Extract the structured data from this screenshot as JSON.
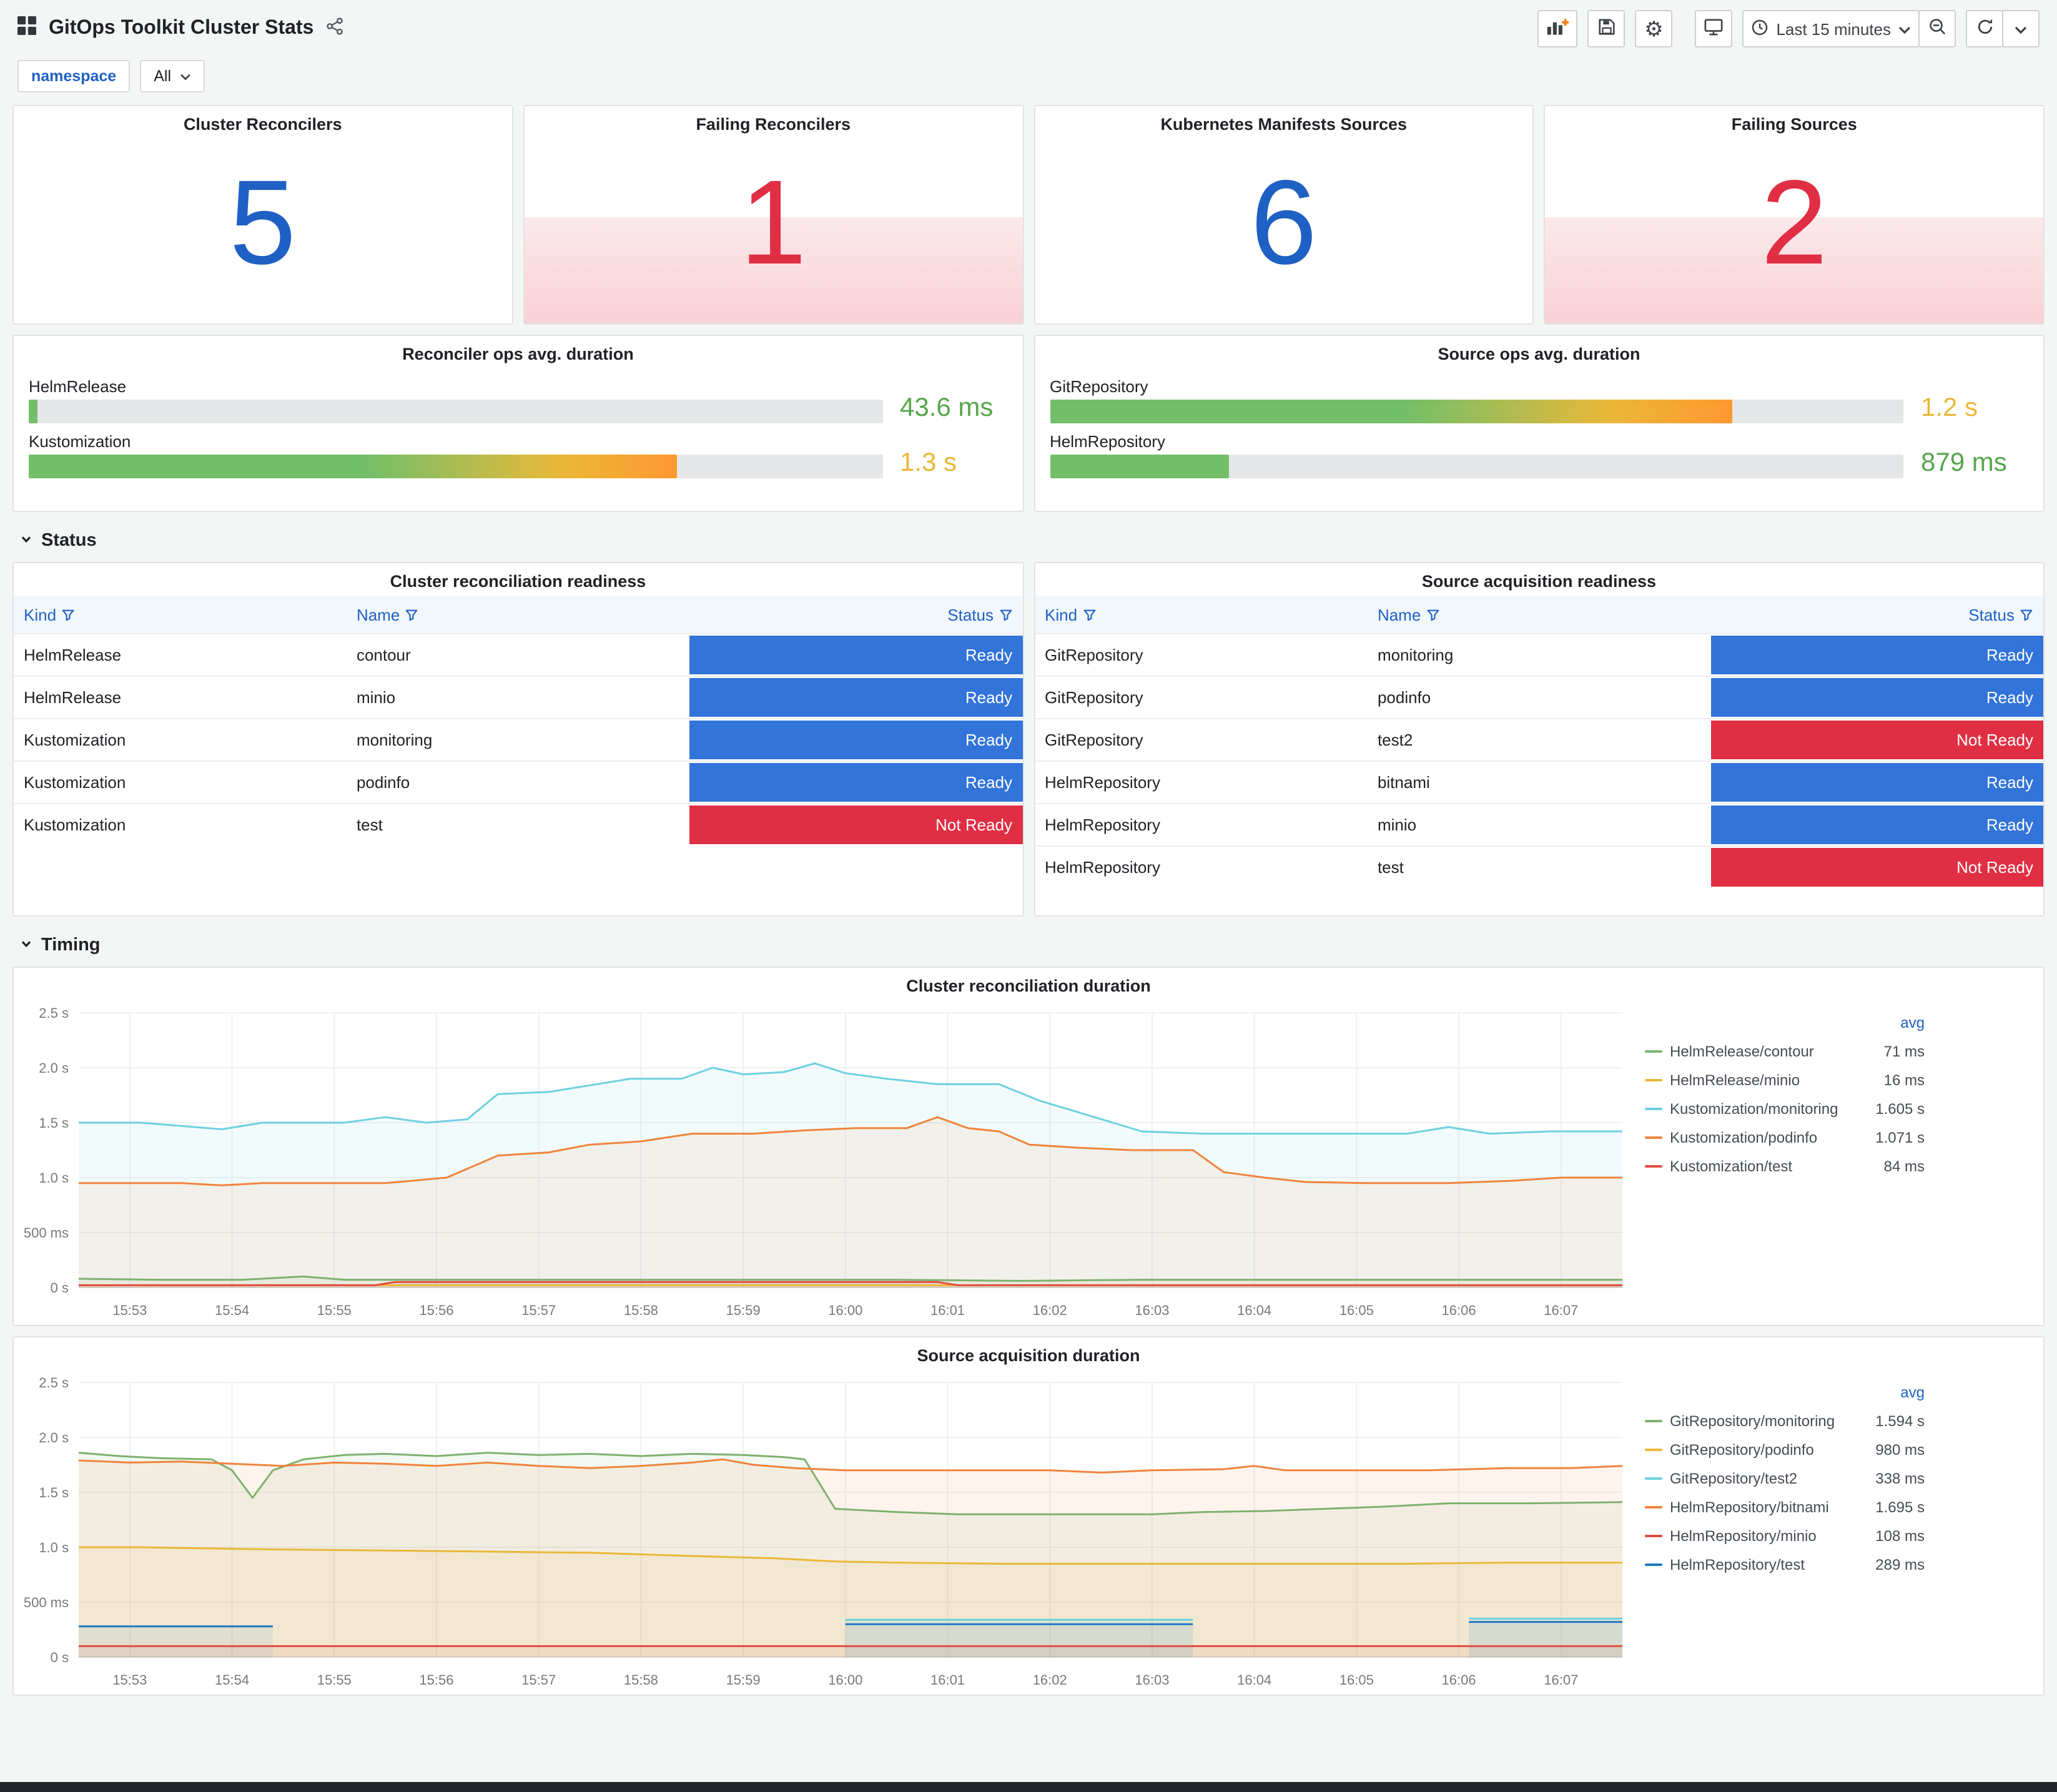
{
  "header": {
    "title": "GitOps Toolkit Cluster Stats",
    "toolbar": {
      "time_range": "Last 15 minutes"
    }
  },
  "variables": {
    "namespace_label": "namespace",
    "namespace_value": "All"
  },
  "sections": {
    "status": "Status",
    "timing": "Timing"
  },
  "stats": [
    {
      "title": "Cluster Reconcilers",
      "value": "5",
      "value_color": "#1F60C4",
      "alert": false
    },
    {
      "title": "Failing Reconcilers",
      "value": "1",
      "value_color": "#E02F44",
      "alert": true
    },
    {
      "title": "Kubernetes Manifests Sources",
      "value": "6",
      "value_color": "#1F60C4",
      "alert": false
    },
    {
      "title": "Failing Sources",
      "value": "2",
      "value_color": "#E02F44",
      "alert": true
    }
  ],
  "gauges": [
    {
      "title": "Reconciler ops avg. duration",
      "rows": [
        {
          "label": "HelmRelease",
          "value": "43.6 ms",
          "value_color": "#56A64B",
          "pct": 1,
          "bar_gradient": [
            [
              "#73BF69",
              0
            ],
            [
              "#73BF69",
              100
            ]
          ]
        },
        {
          "label": "Kustomization",
          "value": "1.3 s",
          "value_color": "#EAB839",
          "pct": 76,
          "bar_gradient": [
            [
              "#73BF69",
              0
            ],
            [
              "#73BF69",
              52
            ],
            [
              "#EAB839",
              82
            ],
            [
              "#FF9830",
              100
            ]
          ]
        }
      ]
    },
    {
      "title": "Source ops avg. duration",
      "rows": [
        {
          "label": "GitRepository",
          "value": "1.2 s",
          "value_color": "#EAB839",
          "pct": 80,
          "bar_gradient": [
            [
              "#73BF69",
              0
            ],
            [
              "#73BF69",
              52
            ],
            [
              "#EAB839",
              82
            ],
            [
              "#FF9830",
              100
            ]
          ]
        },
        {
          "label": "HelmRepository",
          "value": "879 ms",
          "value_color": "#56A64B",
          "pct": 21,
          "bar_gradient": [
            [
              "#73BF69",
              0
            ],
            [
              "#73BF69",
              100
            ]
          ]
        }
      ]
    }
  ],
  "status_colors": {
    "Ready": "#3274D9",
    "Not Ready": "#E02F44"
  },
  "tables": [
    {
      "title": "Cluster reconciliation readiness",
      "columns": [
        "Kind",
        "Name",
        "Status"
      ],
      "rows": [
        [
          "HelmRelease",
          "contour",
          "Ready"
        ],
        [
          "HelmRelease",
          "minio",
          "Ready"
        ],
        [
          "Kustomization",
          "monitoring",
          "Ready"
        ],
        [
          "Kustomization",
          "podinfo",
          "Ready"
        ],
        [
          "Kustomization",
          "test",
          "Not Ready"
        ]
      ]
    },
    {
      "title": "Source acquisition readiness",
      "columns": [
        "Kind",
        "Name",
        "Status"
      ],
      "rows": [
        [
          "GitRepository",
          "monitoring",
          "Ready"
        ],
        [
          "GitRepository",
          "podinfo",
          "Ready"
        ],
        [
          "GitRepository",
          "test2",
          "Not Ready"
        ],
        [
          "HelmRepository",
          "bitnami",
          "Ready"
        ],
        [
          "HelmRepository",
          "minio",
          "Ready"
        ],
        [
          "HelmRepository",
          "test",
          "Not Ready"
        ]
      ]
    }
  ],
  "chart_data": [
    {
      "type": "line",
      "title": "Cluster reconciliation duration",
      "legend_header": "avg",
      "legend_position": "right",
      "grid": true,
      "x_domain": [
        0,
        15.1
      ],
      "x_tick_labels": [
        "15:53",
        "15:54",
        "15:55",
        "15:56",
        "15:57",
        "15:58",
        "15:59",
        "16:00",
        "16:01",
        "16:02",
        "16:03",
        "16:04",
        "16:05",
        "16:06",
        "16:07"
      ],
      "ylim": [
        0,
        2.5
      ],
      "y_unit": "seconds",
      "y_ticks": [
        {
          "v": 0,
          "label": "0 s"
        },
        {
          "v": 0.5,
          "label": "500 ms"
        },
        {
          "v": 1,
          "label": "1.0 s"
        },
        {
          "v": 1.5,
          "label": "1.5 s"
        },
        {
          "v": 2,
          "label": "2.0 s"
        },
        {
          "v": 2.5,
          "label": "2.5 s"
        }
      ],
      "series": [
        {
          "name": "HelmRelease/contour",
          "avg": "71 ms",
          "color": "#7EB26D",
          "points": [
            [
              0,
              0.08
            ],
            [
              0.8,
              0.07
            ],
            [
              1.6,
              0.07
            ],
            [
              2.2,
              0.1
            ],
            [
              2.6,
              0.07
            ],
            [
              3.4,
              0.07
            ],
            [
              4.4,
              0.07
            ],
            [
              5.6,
              0.07
            ],
            [
              6.8,
              0.07
            ],
            [
              8,
              0.07
            ],
            [
              9.2,
              0.06
            ],
            [
              10.4,
              0.07
            ],
            [
              11.6,
              0.07
            ],
            [
              12.8,
              0.07
            ],
            [
              14,
              0.07
            ],
            [
              15.1,
              0.07
            ]
          ]
        },
        {
          "name": "HelmRelease/minio",
          "avg": "16 ms",
          "color": "#EAB839",
          "points": [
            [
              0,
              0.02
            ],
            [
              15.1,
              0.02
            ]
          ]
        },
        {
          "name": "Kustomization/monitoring",
          "avg": "1.605 s",
          "color": "#6ED0E0",
          "points": [
            [
              0,
              1.5
            ],
            [
              0.6,
              1.5
            ],
            [
              1,
              1.47
            ],
            [
              1.4,
              1.44
            ],
            [
              1.8,
              1.5
            ],
            [
              2.6,
              1.5
            ],
            [
              3,
              1.55
            ],
            [
              3.4,
              1.5
            ],
            [
              3.8,
              1.53
            ],
            [
              4.1,
              1.76
            ],
            [
              4.6,
              1.78
            ],
            [
              5,
              1.84
            ],
            [
              5.4,
              1.9
            ],
            [
              5.9,
              1.9
            ],
            [
              6.2,
              2.0
            ],
            [
              6.5,
              1.94
            ],
            [
              6.9,
              1.96
            ],
            [
              7.2,
              2.04
            ],
            [
              7.5,
              1.95
            ],
            [
              7.9,
              1.9
            ],
            [
              8.4,
              1.85
            ],
            [
              9,
              1.85
            ],
            [
              9.4,
              1.7
            ],
            [
              9.9,
              1.56
            ],
            [
              10.4,
              1.42
            ],
            [
              11,
              1.4
            ],
            [
              12,
              1.4
            ],
            [
              13,
              1.4
            ],
            [
              13.4,
              1.46
            ],
            [
              13.8,
              1.4
            ],
            [
              14.4,
              1.42
            ],
            [
              15.1,
              1.42
            ]
          ]
        },
        {
          "name": "Kustomization/podinfo",
          "avg": "1.071 s",
          "color": "#EF843C",
          "points": [
            [
              0,
              0.95
            ],
            [
              1,
              0.95
            ],
            [
              1.4,
              0.93
            ],
            [
              1.8,
              0.95
            ],
            [
              3,
              0.95
            ],
            [
              3.6,
              1.0
            ],
            [
              4.1,
              1.2
            ],
            [
              4.6,
              1.23
            ],
            [
              5,
              1.3
            ],
            [
              5.5,
              1.33
            ],
            [
              6,
              1.4
            ],
            [
              6.6,
              1.4
            ],
            [
              7.1,
              1.43
            ],
            [
              7.6,
              1.45
            ],
            [
              8.1,
              1.45
            ],
            [
              8.4,
              1.55
            ],
            [
              8.7,
              1.45
            ],
            [
              9,
              1.42
            ],
            [
              9.3,
              1.3
            ],
            [
              9.8,
              1.27
            ],
            [
              10.3,
              1.25
            ],
            [
              10.9,
              1.25
            ],
            [
              11.2,
              1.05
            ],
            [
              11.6,
              1.0
            ],
            [
              12,
              0.96
            ],
            [
              12.6,
              0.95
            ],
            [
              13.4,
              0.95
            ],
            [
              14,
              0.97
            ],
            [
              14.5,
              1.0
            ],
            [
              15.1,
              1.0
            ]
          ]
        },
        {
          "name": "Kustomization/test",
          "avg": "84 ms",
          "color": "#E24D42",
          "points": [
            [
              0,
              0.02
            ],
            [
              2.9,
              0.02
            ],
            [
              3.1,
              0.05
            ],
            [
              8.4,
              0.05
            ],
            [
              8.6,
              0.02
            ],
            [
              15.1,
              0.02
            ]
          ]
        }
      ]
    },
    {
      "type": "line",
      "title": "Source acquisition duration",
      "legend_header": "avg",
      "legend_position": "right",
      "grid": true,
      "x_domain": [
        0,
        15.1
      ],
      "x_tick_labels": [
        "15:53",
        "15:54",
        "15:55",
        "15:56",
        "15:57",
        "15:58",
        "15:59",
        "16:00",
        "16:01",
        "16:02",
        "16:03",
        "16:04",
        "16:05",
        "16:06",
        "16:07"
      ],
      "ylim": [
        0,
        2.5
      ],
      "y_unit": "seconds",
      "y_ticks": [
        {
          "v": 0,
          "label": "0 s"
        },
        {
          "v": 0.5,
          "label": "500 ms"
        },
        {
          "v": 1,
          "label": "1.0 s"
        },
        {
          "v": 1.5,
          "label": "1.5 s"
        },
        {
          "v": 2,
          "label": "2.0 s"
        },
        {
          "v": 2.5,
          "label": "2.5 s"
        }
      ],
      "series": [
        {
          "name": "GitRepository/monitoring",
          "avg": "1.594 s",
          "color": "#7EB26D",
          "points": [
            [
              0,
              1.86
            ],
            [
              0.4,
              1.83
            ],
            [
              0.8,
              1.81
            ],
            [
              1.3,
              1.8
            ],
            [
              1.5,
              1.7
            ],
            [
              1.7,
              1.45
            ],
            [
              1.9,
              1.7
            ],
            [
              2.2,
              1.8
            ],
            [
              2.6,
              1.84
            ],
            [
              3,
              1.85
            ],
            [
              3.5,
              1.83
            ],
            [
              4,
              1.86
            ],
            [
              4.5,
              1.84
            ],
            [
              5,
              1.85
            ],
            [
              5.5,
              1.83
            ],
            [
              6,
              1.85
            ],
            [
              6.5,
              1.84
            ],
            [
              6.9,
              1.82
            ],
            [
              7.1,
              1.8
            ],
            [
              7.4,
              1.35
            ],
            [
              8,
              1.32
            ],
            [
              8.6,
              1.3
            ],
            [
              9.5,
              1.3
            ],
            [
              10.5,
              1.3
            ],
            [
              11,
              1.32
            ],
            [
              11.6,
              1.33
            ],
            [
              12.2,
              1.35
            ],
            [
              12.8,
              1.37
            ],
            [
              13.4,
              1.4
            ],
            [
              14.2,
              1.4
            ],
            [
              15.1,
              1.41
            ]
          ]
        },
        {
          "name": "GitRepository/podinfo",
          "avg": "980 ms",
          "color": "#EAB839",
          "points": [
            [
              0,
              1.0
            ],
            [
              0.6,
              1.0
            ],
            [
              1.2,
              0.99
            ],
            [
              2,
              0.98
            ],
            [
              3,
              0.97
            ],
            [
              4,
              0.96
            ],
            [
              5,
              0.95
            ],
            [
              6,
              0.92
            ],
            [
              6.8,
              0.9
            ],
            [
              7.4,
              0.87
            ],
            [
              8,
              0.86
            ],
            [
              9,
              0.85
            ],
            [
              10,
              0.85
            ],
            [
              11,
              0.85
            ],
            [
              12,
              0.85
            ],
            [
              13,
              0.85
            ],
            [
              14,
              0.86
            ],
            [
              15.1,
              0.86
            ]
          ]
        },
        {
          "name": "GitRepository/test2",
          "avg": "338 ms",
          "color": "#6ED0E0",
          "points": [
            [
              7.5,
              0.34
            ],
            [
              10.9,
              0.34
            ],
            null,
            [
              13.6,
              0.35
            ],
            [
              15.1,
              0.35
            ]
          ]
        },
        {
          "name": "HelmRepository/bitnami",
          "avg": "1.695 s",
          "color": "#EF843C",
          "points": [
            [
              0,
              1.79
            ],
            [
              0.5,
              1.77
            ],
            [
              1,
              1.78
            ],
            [
              1.5,
              1.76
            ],
            [
              2,
              1.74
            ],
            [
              2.5,
              1.77
            ],
            [
              3,
              1.76
            ],
            [
              3.5,
              1.74
            ],
            [
              4,
              1.77
            ],
            [
              4.5,
              1.74
            ],
            [
              5,
              1.72
            ],
            [
              5.5,
              1.74
            ],
            [
              6,
              1.77
            ],
            [
              6.3,
              1.8
            ],
            [
              6.6,
              1.75
            ],
            [
              7,
              1.72
            ],
            [
              7.5,
              1.7
            ],
            [
              8.5,
              1.7
            ],
            [
              9.5,
              1.7
            ],
            [
              10,
              1.68
            ],
            [
              10.5,
              1.7
            ],
            [
              11.2,
              1.71
            ],
            [
              11.5,
              1.74
            ],
            [
              11.8,
              1.7
            ],
            [
              12.5,
              1.7
            ],
            [
              13.2,
              1.7
            ],
            [
              14,
              1.72
            ],
            [
              14.6,
              1.72
            ],
            [
              15.1,
              1.74
            ]
          ]
        },
        {
          "name": "HelmRepository/minio",
          "avg": "108 ms",
          "color": "#E24D42",
          "points": [
            [
              0,
              0.1
            ],
            [
              15.1,
              0.1
            ]
          ]
        },
        {
          "name": "HelmRepository/test",
          "avg": "289 ms",
          "color": "#1F78C1",
          "points": [
            [
              0,
              0.28
            ],
            [
              1.9,
              0.28
            ],
            null,
            [
              7.5,
              0.3
            ],
            [
              10.9,
              0.3
            ],
            null,
            [
              13.6,
              0.32
            ],
            [
              15.1,
              0.32
            ]
          ]
        }
      ]
    }
  ]
}
